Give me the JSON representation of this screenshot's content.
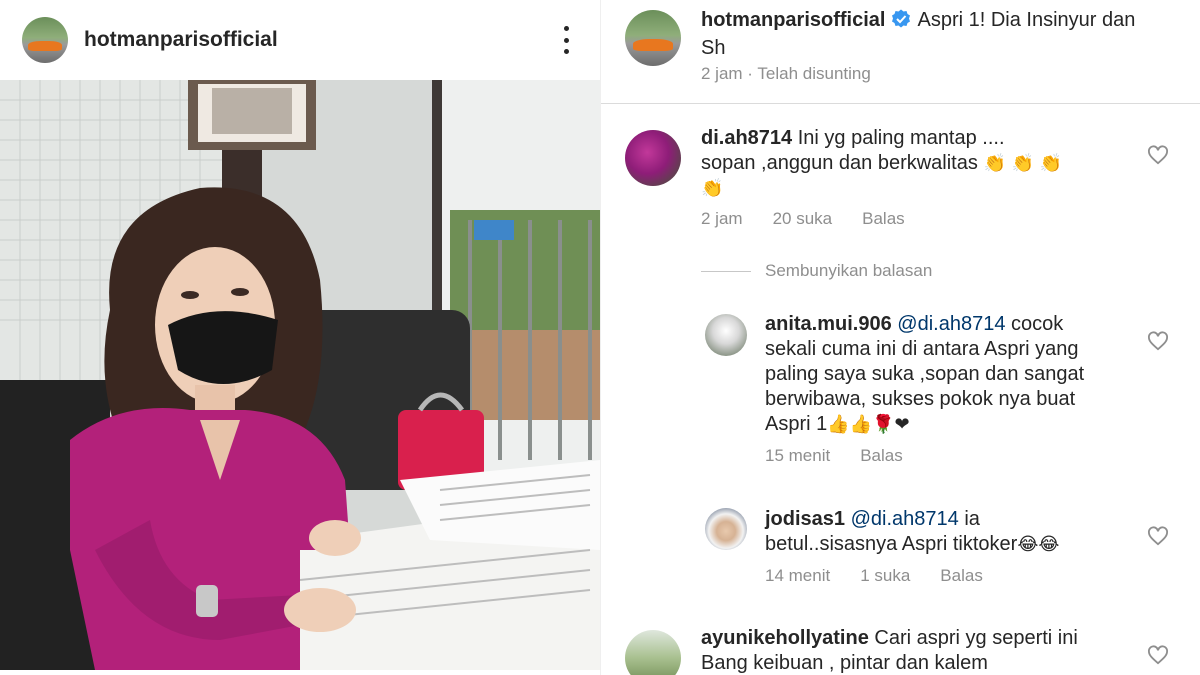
{
  "post": {
    "username": "hotmanparisofficial",
    "avatar_icon": "profile-car-avatar",
    "more_icon": "more-options-icon",
    "photo_label": ""
  },
  "caption": {
    "username": "hotmanparisofficial",
    "verified_icon": "verified-badge-icon",
    "verified_color": "#3897f0",
    "text": "Aspri 1! Dia Insinyur dan Sh",
    "time": "2 jam",
    "edited": "Telah disunting"
  },
  "comments": [
    {
      "username": "di.ah8714",
      "text_line1": "Ini yg paling mantap ....",
      "text_line2": "sopan ,anggun  dan berkwalitas",
      "emoji_line2": "👏 👏 👏",
      "emoji_line3": "👏",
      "time": "2 jam",
      "likes": "20 suka",
      "reply": "Balas"
    }
  ],
  "hide_replies": "Sembunyikan balasan",
  "replies": [
    {
      "username": "anita.mui.906",
      "mention": "@di.ah8714",
      "line1_rest": "cocok",
      "line2": "sekali cuma ini di antara Aspri yang",
      "line3": "paling saya suka ,sopan dan sangat",
      "line4": "berwibawa, sukses pokok nya buat",
      "line5": "Aspri 1",
      "emoji": "👍👍🌹❤",
      "time": "15 menit",
      "reply": "Balas"
    },
    {
      "username": "jodisas1",
      "mention": "@di.ah8714",
      "line1_rest": "ia",
      "line2": "betul..sisasnya Aspri tiktoker",
      "emoji": "😂😂",
      "time": "14 menit",
      "likes": "1 suka",
      "reply": "Balas"
    }
  ],
  "comment3": {
    "username": "ayunikehollyatine",
    "line1_rest": "Cari aspri yg seperti ini",
    "line2": "Bang keibuan , pintar dan kalem"
  },
  "colors": {
    "text": "#262626",
    "muted": "#8e8e8e",
    "mention": "#00376b",
    "heart_outline": "#8e8e8e"
  }
}
